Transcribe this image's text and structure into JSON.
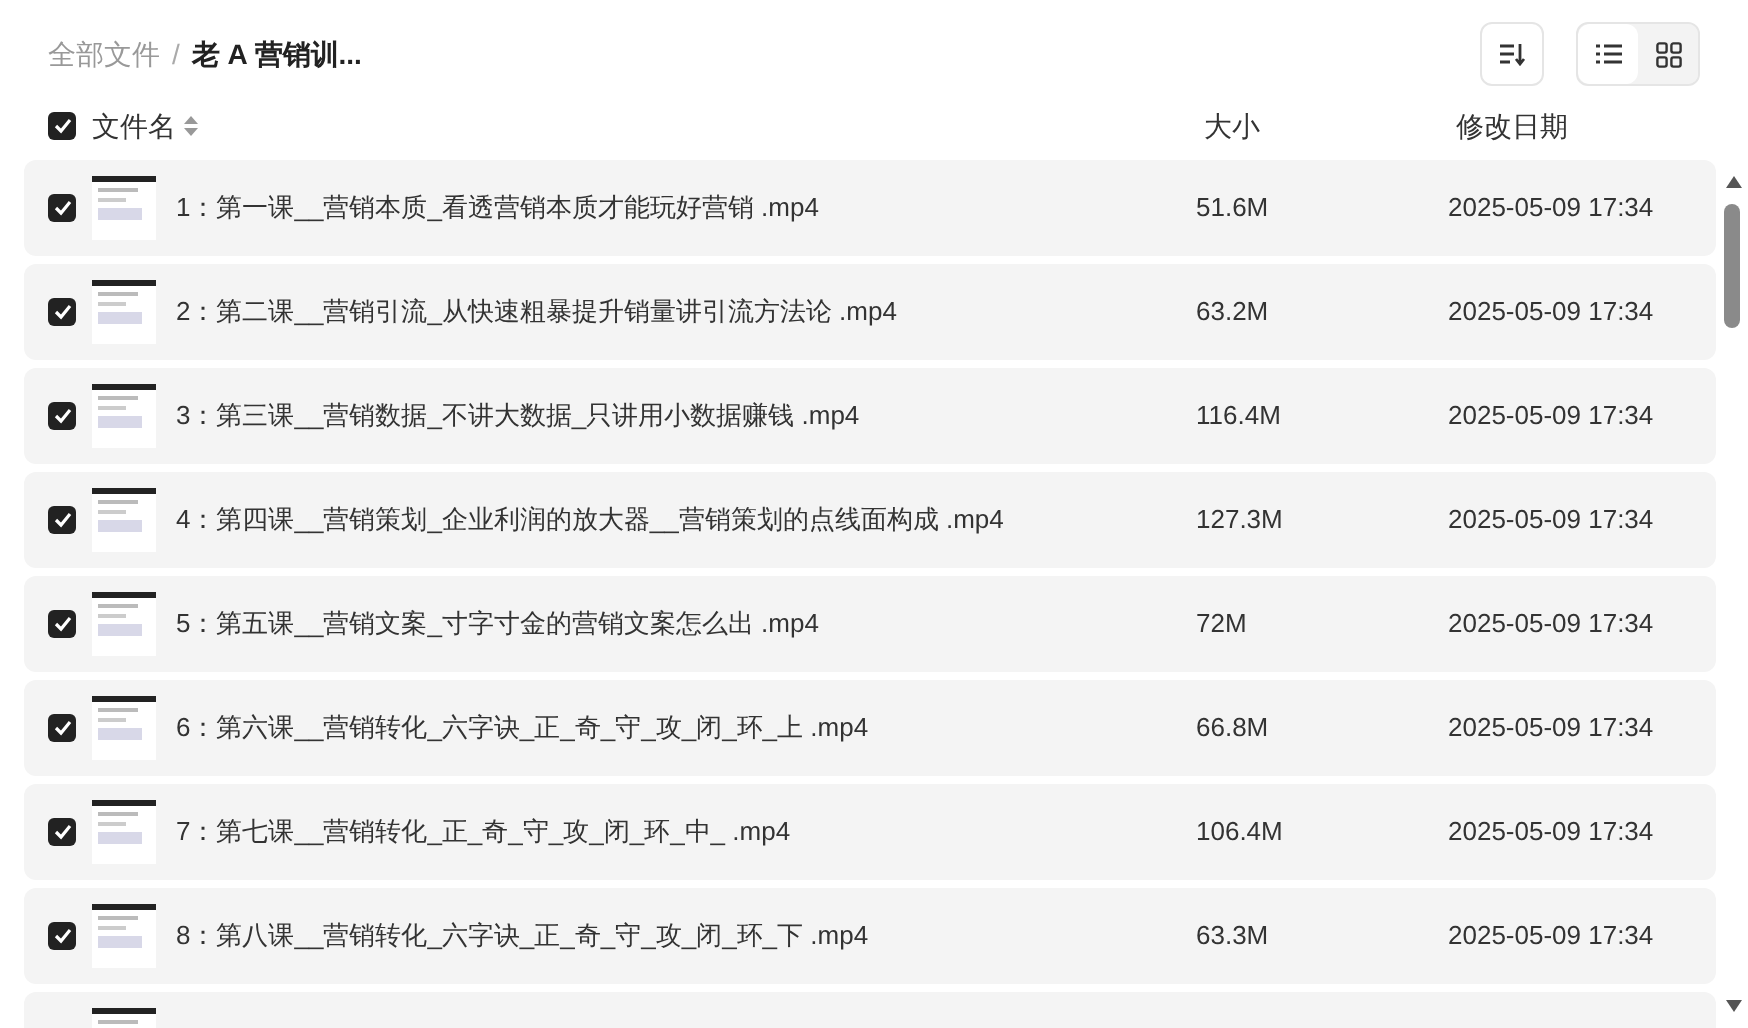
{
  "breadcrumb": [
    {
      "label": "全部文件",
      "current": false
    },
    {
      "label": "老 A 营销训...",
      "current": true
    }
  ],
  "breadcrumb_separator": "/",
  "view_modes": [
    {
      "kind": "list",
      "selected": true
    },
    {
      "kind": "grid",
      "selected": false
    }
  ],
  "header": {
    "select_all_checked": true,
    "columns": [
      "文件名",
      "大小",
      "修改日期"
    ]
  },
  "rows": [
    {
      "checked": true,
      "name": "1：第一课__营销本质_看透营销本质才能玩好营销 .mp4",
      "size": "51.6M",
      "date": "2025-05-09 17:34"
    },
    {
      "checked": true,
      "name": "2：第二课__营销引流_从快速粗暴提升销量讲引流方法论 .mp4",
      "size": "63.2M",
      "date": "2025-05-09 17:34"
    },
    {
      "checked": true,
      "name": "3：第三课__营销数据_不讲大数据_只讲用小数据赚钱 .mp4",
      "size": "116.4M",
      "date": "2025-05-09 17:34"
    },
    {
      "checked": true,
      "name": "4：第四课__营销策划_企业利润的放大器__营销策划的点线面构成 .mp4",
      "size": "127.3M",
      "date": "2025-05-09 17:34"
    },
    {
      "checked": true,
      "name": "5：第五课__营销文案_寸字寸金的营销文案怎么出 .mp4",
      "size": "72M",
      "date": "2025-05-09 17:34"
    },
    {
      "checked": true,
      "name": "6：第六课__营销转化_六字诀_正_奇_守_攻_闭_环_上 .mp4",
      "size": "66.8M",
      "date": "2025-05-09 17:34"
    },
    {
      "checked": true,
      "name": "7：第七课__营销转化_正_奇_守_攻_闭_环_中_ .mp4",
      "size": "106.4M",
      "date": "2025-05-09 17:34"
    },
    {
      "checked": true,
      "name": "8：第八课__营销转化_六字诀_正_奇_守_攻_闭_环_下 .mp4",
      "size": "63.3M",
      "date": "2025-05-09 17:34"
    },
    {}
  ]
}
